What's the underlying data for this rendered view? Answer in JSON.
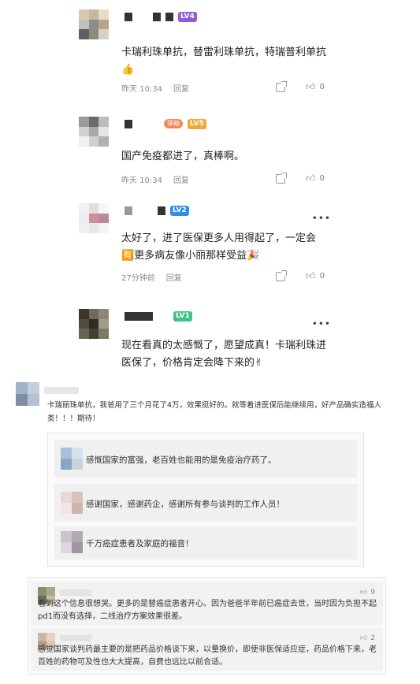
{
  "thread": {
    "comments": [
      {
        "level": "LV4",
        "level_color": "#8f5bd6",
        "text": "卡瑞利珠单抗，替雷利珠单抗，特瑞普利单抗👍",
        "time": "昨天 10:34",
        "reply": "回复",
        "likes": "0"
      },
      {
        "badge": "领袖",
        "level": "LV5",
        "level_color": "#f2a53a",
        "text": "国产免疫都进了，真棒啊。",
        "time": "昨天 10:34",
        "reply": "回复",
        "likes": "0"
      },
      {
        "level": "LV2",
        "level_color": "#2e8fe5",
        "text": "太好了，进了医保更多人用得起了，一定会🈶更多病友像小丽那样受益🎉",
        "time": "27分钟前",
        "reply": "回复",
        "likes": "0"
      },
      {
        "level": "LV1",
        "level_color": "#3cc28a",
        "text": "现在看真的太感慨了，愿望成真！卡瑞利珠进医保了，价格肯定会降下来的✌"
      }
    ]
  },
  "weibo": {
    "text": "卡瑞丽珠单抗，我爸用了三个月花了4万，效果挺好的。就等着进医保后能继续用，好产品确实造福人类！！！期待！",
    "replies": [
      "感慨国家的富强，老百姓也能用的是免疫治疗药了。",
      "感谢国家，感谢药企，感谢所有参与谈判的工作人员！",
      "千万癌症患者及家庭的福音！"
    ]
  },
  "comments2": [
    {
      "text": "看到这个信息很想哭。更多的是替癌症患者开心。因为爸爸半年前已癌症去世，当时因为负担不起pd1而没有选择，二线治疗方案效果很差。",
      "likes": "9"
    },
    {
      "text": "感觉国家谈判药最主要的是把药品价格谈下来，以量换价，即使非医保适应症，药品价格下来，老百姓的药物可及性也大大提高，自费也远比以前合适。",
      "likes": "2"
    }
  ],
  "icons": {
    "more": "more-dots-icon",
    "share": "share-icon",
    "like": "thumbs-up-icon"
  }
}
